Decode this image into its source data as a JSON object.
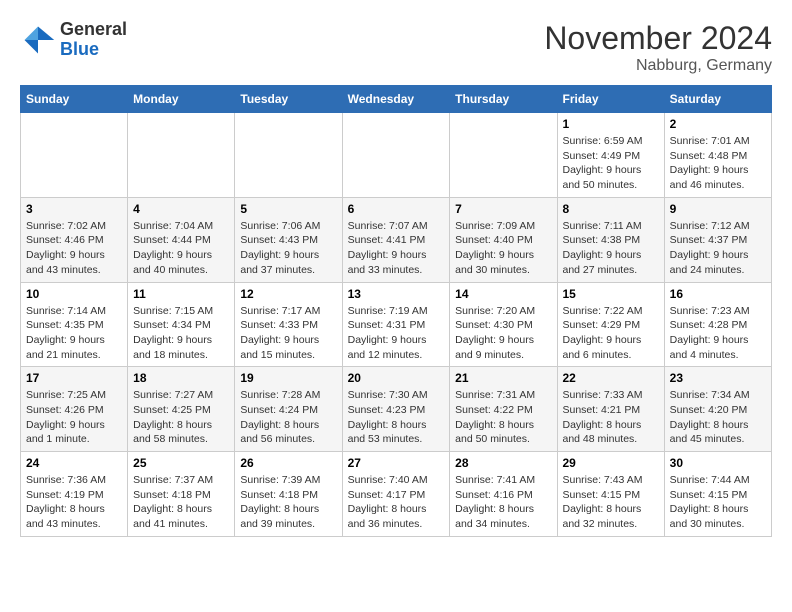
{
  "header": {
    "logo_general": "General",
    "logo_blue": "Blue",
    "month_title": "November 2024",
    "location": "Nabburg, Germany"
  },
  "days_of_week": [
    "Sunday",
    "Monday",
    "Tuesday",
    "Wednesday",
    "Thursday",
    "Friday",
    "Saturday"
  ],
  "weeks": [
    [
      {
        "day": "",
        "info": ""
      },
      {
        "day": "",
        "info": ""
      },
      {
        "day": "",
        "info": ""
      },
      {
        "day": "",
        "info": ""
      },
      {
        "day": "",
        "info": ""
      },
      {
        "day": "1",
        "info": "Sunrise: 6:59 AM\nSunset: 4:49 PM\nDaylight: 9 hours and 50 minutes."
      },
      {
        "day": "2",
        "info": "Sunrise: 7:01 AM\nSunset: 4:48 PM\nDaylight: 9 hours and 46 minutes."
      }
    ],
    [
      {
        "day": "3",
        "info": "Sunrise: 7:02 AM\nSunset: 4:46 PM\nDaylight: 9 hours and 43 minutes."
      },
      {
        "day": "4",
        "info": "Sunrise: 7:04 AM\nSunset: 4:44 PM\nDaylight: 9 hours and 40 minutes."
      },
      {
        "day": "5",
        "info": "Sunrise: 7:06 AM\nSunset: 4:43 PM\nDaylight: 9 hours and 37 minutes."
      },
      {
        "day": "6",
        "info": "Sunrise: 7:07 AM\nSunset: 4:41 PM\nDaylight: 9 hours and 33 minutes."
      },
      {
        "day": "7",
        "info": "Sunrise: 7:09 AM\nSunset: 4:40 PM\nDaylight: 9 hours and 30 minutes."
      },
      {
        "day": "8",
        "info": "Sunrise: 7:11 AM\nSunset: 4:38 PM\nDaylight: 9 hours and 27 minutes."
      },
      {
        "day": "9",
        "info": "Sunrise: 7:12 AM\nSunset: 4:37 PM\nDaylight: 9 hours and 24 minutes."
      }
    ],
    [
      {
        "day": "10",
        "info": "Sunrise: 7:14 AM\nSunset: 4:35 PM\nDaylight: 9 hours and 21 minutes."
      },
      {
        "day": "11",
        "info": "Sunrise: 7:15 AM\nSunset: 4:34 PM\nDaylight: 9 hours and 18 minutes."
      },
      {
        "day": "12",
        "info": "Sunrise: 7:17 AM\nSunset: 4:33 PM\nDaylight: 9 hours and 15 minutes."
      },
      {
        "day": "13",
        "info": "Sunrise: 7:19 AM\nSunset: 4:31 PM\nDaylight: 9 hours and 12 minutes."
      },
      {
        "day": "14",
        "info": "Sunrise: 7:20 AM\nSunset: 4:30 PM\nDaylight: 9 hours and 9 minutes."
      },
      {
        "day": "15",
        "info": "Sunrise: 7:22 AM\nSunset: 4:29 PM\nDaylight: 9 hours and 6 minutes."
      },
      {
        "day": "16",
        "info": "Sunrise: 7:23 AM\nSunset: 4:28 PM\nDaylight: 9 hours and 4 minutes."
      }
    ],
    [
      {
        "day": "17",
        "info": "Sunrise: 7:25 AM\nSunset: 4:26 PM\nDaylight: 9 hours and 1 minute."
      },
      {
        "day": "18",
        "info": "Sunrise: 7:27 AM\nSunset: 4:25 PM\nDaylight: 8 hours and 58 minutes."
      },
      {
        "day": "19",
        "info": "Sunrise: 7:28 AM\nSunset: 4:24 PM\nDaylight: 8 hours and 56 minutes."
      },
      {
        "day": "20",
        "info": "Sunrise: 7:30 AM\nSunset: 4:23 PM\nDaylight: 8 hours and 53 minutes."
      },
      {
        "day": "21",
        "info": "Sunrise: 7:31 AM\nSunset: 4:22 PM\nDaylight: 8 hours and 50 minutes."
      },
      {
        "day": "22",
        "info": "Sunrise: 7:33 AM\nSunset: 4:21 PM\nDaylight: 8 hours and 48 minutes."
      },
      {
        "day": "23",
        "info": "Sunrise: 7:34 AM\nSunset: 4:20 PM\nDaylight: 8 hours and 45 minutes."
      }
    ],
    [
      {
        "day": "24",
        "info": "Sunrise: 7:36 AM\nSunset: 4:19 PM\nDaylight: 8 hours and 43 minutes."
      },
      {
        "day": "25",
        "info": "Sunrise: 7:37 AM\nSunset: 4:18 PM\nDaylight: 8 hours and 41 minutes."
      },
      {
        "day": "26",
        "info": "Sunrise: 7:39 AM\nSunset: 4:18 PM\nDaylight: 8 hours and 39 minutes."
      },
      {
        "day": "27",
        "info": "Sunrise: 7:40 AM\nSunset: 4:17 PM\nDaylight: 8 hours and 36 minutes."
      },
      {
        "day": "28",
        "info": "Sunrise: 7:41 AM\nSunset: 4:16 PM\nDaylight: 8 hours and 34 minutes."
      },
      {
        "day": "29",
        "info": "Sunrise: 7:43 AM\nSunset: 4:15 PM\nDaylight: 8 hours and 32 minutes."
      },
      {
        "day": "30",
        "info": "Sunrise: 7:44 AM\nSunset: 4:15 PM\nDaylight: 8 hours and 30 minutes."
      }
    ]
  ]
}
